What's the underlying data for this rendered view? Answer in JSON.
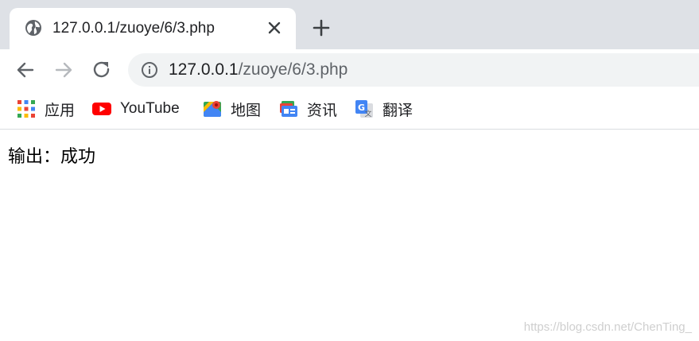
{
  "colors": {
    "tabstrip_bg": "#dee1e6",
    "omnibox_bg": "#f1f3f4",
    "icon_gray": "#5f6368",
    "text": "#202124",
    "youtube_red": "#ff0000"
  },
  "tab": {
    "favicon": "globe-icon",
    "title": "127.0.0.1/zuoye/6/3.php",
    "close_icon": "close-icon"
  },
  "new_tab_icon": "plus-icon",
  "toolbar": {
    "back_icon": "arrow-left-icon",
    "forward_icon": "arrow-right-icon",
    "reload_icon": "reload-icon",
    "info_icon": "info-icon"
  },
  "omnibox": {
    "host": "127.0.0.1",
    "path": "/zuoye/6/3.php"
  },
  "bookmarks": [
    {
      "label": "应用",
      "icon": "apps-grid-icon"
    },
    {
      "label": "YouTube",
      "icon": "youtube-icon"
    },
    {
      "label": "地图",
      "icon": "maps-icon"
    },
    {
      "label": "资讯",
      "icon": "news-icon"
    },
    {
      "label": "翻译",
      "icon": "translate-icon"
    }
  ],
  "content": {
    "output_text": "输出：成功"
  },
  "watermark": "https://blog.csdn.net/ChenTing_"
}
